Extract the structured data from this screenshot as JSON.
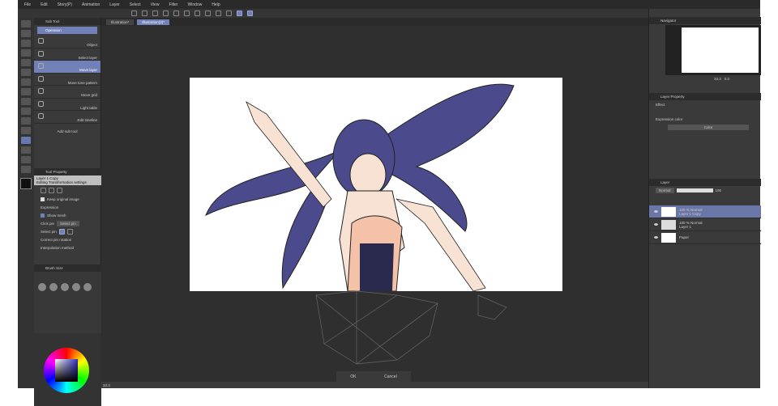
{
  "menu": [
    "File",
    "Edit",
    "Story(P)",
    "Animation",
    "Layer",
    "Select",
    "View",
    "Filter",
    "Window",
    "Help"
  ],
  "doc_tabs": [
    "Illustration*",
    "Illustration(2)*"
  ],
  "subtool": {
    "tab": "Sub Tool",
    "group": "Operation",
    "items": [
      "Object",
      "Select layer",
      "Move layer",
      "Move tone pattern",
      "Move grid",
      "Light table",
      "Edit timeline"
    ],
    "selected": "Move layer",
    "add": "Add sub tool"
  },
  "tool_property": {
    "tab": "Tool Property",
    "layer": "Layer 1 Copy",
    "mode": "Editing Transformation settings",
    "keep_original": "Keep original image",
    "expression": "Expression",
    "show_mesh": "Show mesh",
    "click_pin_label": "Click pin",
    "click_pin_value": "Select pin",
    "select_pin_label": "Select pin",
    "correct_pin": "Correct pin rotation",
    "interpolation": "Interpolation method"
  },
  "brush_size_tab": "Brush Size",
  "canvas_dialog": {
    "ok": "OK",
    "cancel": "Cancel"
  },
  "navigator": {
    "tab": "Navigator",
    "zoom": "33.3",
    "angle": "0.0"
  },
  "layer_property": {
    "tab": "Layer Property",
    "effect": "Effect",
    "expression_color": "Expression color",
    "color_value": "Color"
  },
  "layers": {
    "tab": "Layer",
    "blend": "Normal",
    "opacity": "100",
    "items": [
      {
        "mode": "100 % Normal",
        "name": "Layer 1 Copy",
        "selected": true
      },
      {
        "mode": "100 % Normal",
        "name": "Layer 1",
        "selected": false
      },
      {
        "mode": "",
        "name": "Paper",
        "selected": false
      }
    ]
  },
  "status_zoom": "33.3",
  "colors": {
    "accent": "#7280b8",
    "hair": "#4a4a8c",
    "skin": "#f4c2a8"
  }
}
